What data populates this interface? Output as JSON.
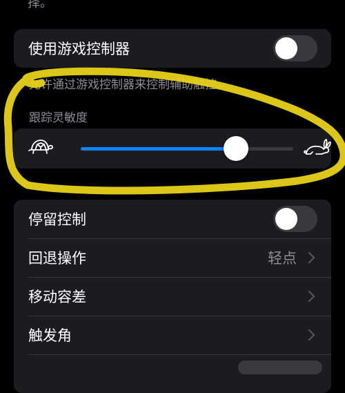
{
  "top_fragment": "择。",
  "game_controller": {
    "label": "使用游戏控制器",
    "enabled": false,
    "footer": "允许通过游戏控制器来控制辅助触控。"
  },
  "tracking_sensitivity": {
    "header": "跟踪灵敏度",
    "value": 0.73,
    "min_icon": "turtle-icon",
    "max_icon": "rabbit-icon"
  },
  "dwell_settings": {
    "rows": [
      {
        "label": "停留控制",
        "type": "toggle",
        "enabled": false
      },
      {
        "label": "回退操作",
        "type": "nav",
        "value": "轻点"
      },
      {
        "label": "移动容差",
        "type": "nav",
        "value": ""
      },
      {
        "label": "触发角",
        "type": "nav",
        "value": ""
      }
    ]
  },
  "colors": {
    "background": "#000000",
    "group_background": "#1c1c1e",
    "accent": "#0a84ff",
    "secondary_text": "#8e8e93",
    "annotation": "#e8d21a"
  }
}
